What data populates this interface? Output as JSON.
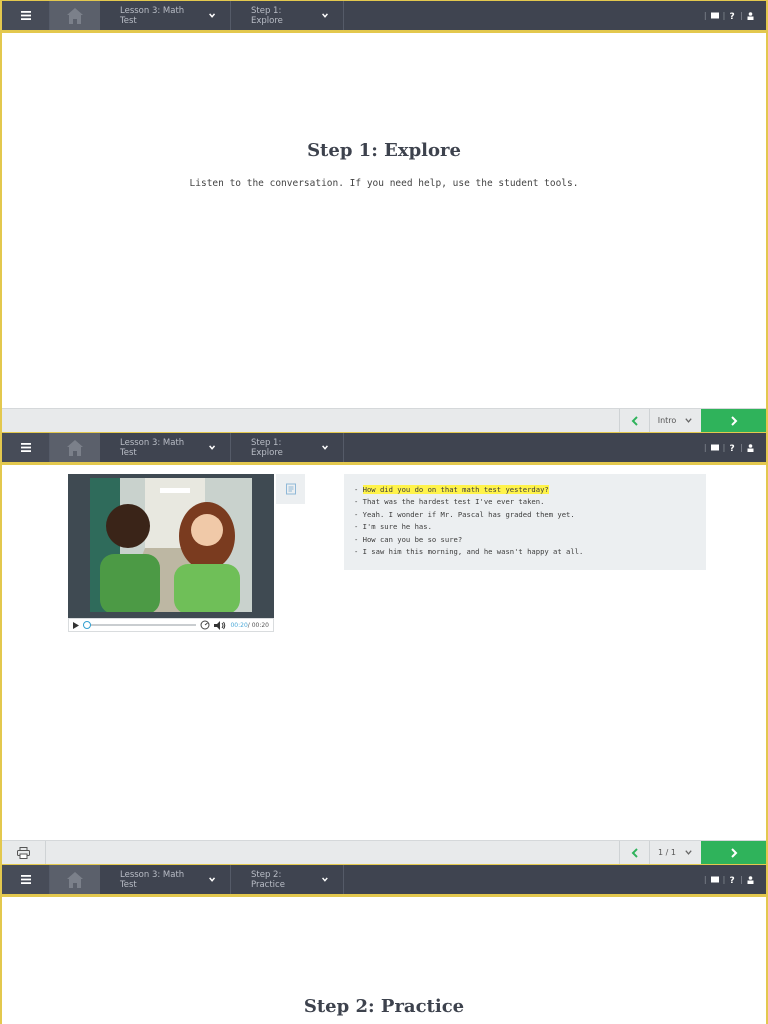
{
  "screens": [
    {
      "topbar": {
        "lesson": "Lesson 3: Math Test",
        "step": "Step 1: Explore"
      },
      "title": "Step 1: Explore",
      "subtitle": "Listen to the conversation. If you need help, use the student tools.",
      "bottom": {
        "page_select": "Intro"
      }
    },
    {
      "topbar": {
        "lesson": "Lesson 3: Math Test",
        "step": "Step 1: Explore"
      },
      "video": {
        "current_time": "00:20",
        "duration": "/ 00:20"
      },
      "transcript": [
        {
          "text": "- ",
          "highlight": "How did you do on that math test yesterday?"
        },
        {
          "text": "- That was the hardest test I've ever taken."
        },
        {
          "text": "- Yeah. I wonder if Mr. Pascal has graded them yet."
        },
        {
          "text": "- I'm sure he has."
        },
        {
          "text": "- How can you be so sure?"
        },
        {
          "text": "- I saw him this morning, and he wasn't happy at all."
        }
      ],
      "bottom": {
        "page_select": "1 / 1"
      }
    },
    {
      "topbar": {
        "lesson": "Lesson 3: Math Test",
        "step": "Step 2: Practice"
      },
      "title": "Step 2: Practice"
    }
  ],
  "icons": {
    "menu": "hamburger-menu-icon",
    "home": "home-icon",
    "glossary": "book-icon",
    "help": "question-icon",
    "user": "user-icon",
    "print": "printer-icon",
    "prev": "chevron-left-icon",
    "next": "chevron-right-icon",
    "transcript": "transcript-icon"
  },
  "colors": {
    "topbar": "#3f4450",
    "accent_border": "#e3c84e",
    "next_button": "#2fb35b",
    "highlight": "#fff34a"
  }
}
